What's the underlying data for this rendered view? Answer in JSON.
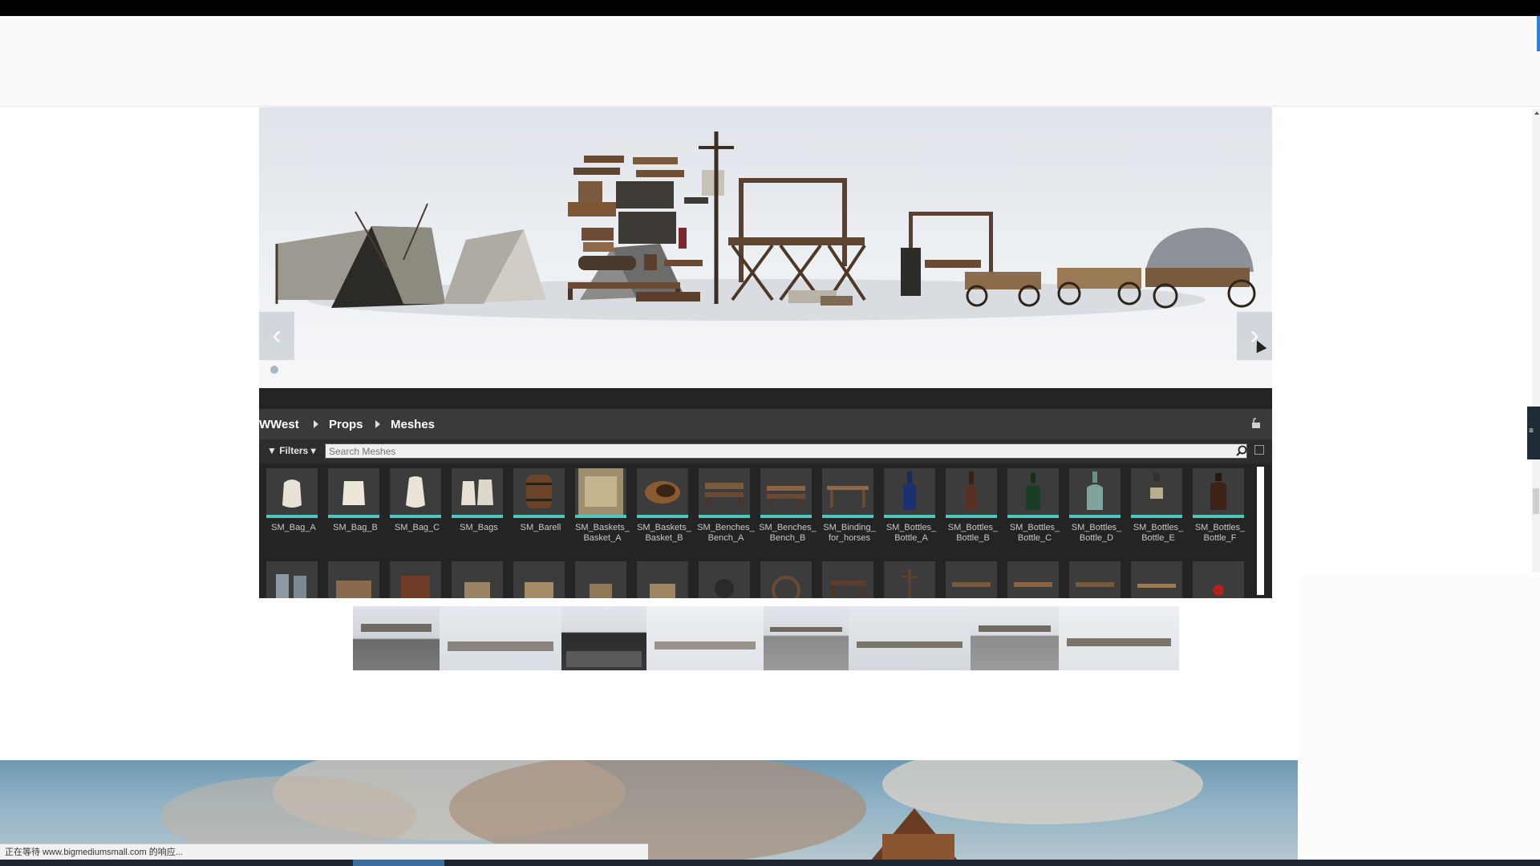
{
  "hero": {
    "prev_glyph": "‹",
    "next_glyph": "›"
  },
  "content_browser": {
    "breadcrumb": [
      "WWest",
      "Props",
      "Meshes"
    ],
    "filters_label": "Filters",
    "search_placeholder": "Search Meshes",
    "assets": [
      {
        "label": "SM_Bag_A",
        "icon": "bag"
      },
      {
        "label": "SM_Bag_B",
        "icon": "bag"
      },
      {
        "label": "SM_Bag_C",
        "icon": "bag"
      },
      {
        "label": "SM_Bags",
        "icon": "bags"
      },
      {
        "label": "SM_Barell",
        "icon": "barrel"
      },
      {
        "label": "SM_Baskets_\nBasket_A",
        "icon": "basket"
      },
      {
        "label": "SM_Baskets_\nBasket_B",
        "icon": "basket-round"
      },
      {
        "label": "SM_Benches_\nBench_A",
        "icon": "bench"
      },
      {
        "label": "SM_Benches_\nBench_B",
        "icon": "bench"
      },
      {
        "label": "SM_Binding_\nfor_horses",
        "icon": "rail"
      },
      {
        "label": "SM_Bottles_\nBottle_A",
        "icon": "bottle"
      },
      {
        "label": "SM_Bottles_\nBottle_B",
        "icon": "bottle"
      },
      {
        "label": "SM_Bottles_\nBottle_C",
        "icon": "bottle"
      },
      {
        "label": "SM_Bottles_\nBottle_D",
        "icon": "bottle"
      },
      {
        "label": "SM_Bottles_\nBottle_E",
        "icon": "bottle"
      },
      {
        "label": "SM_Bottles_\nBottle_F",
        "icon": "bottle"
      }
    ]
  },
  "status_text": "正在等待 www.bigmediumsmall.com 的响应...",
  "colors": {
    "accent_teal": "#4fc7bf",
    "panel_dark": "#242424",
    "header_bar": "#3a3a3a"
  }
}
